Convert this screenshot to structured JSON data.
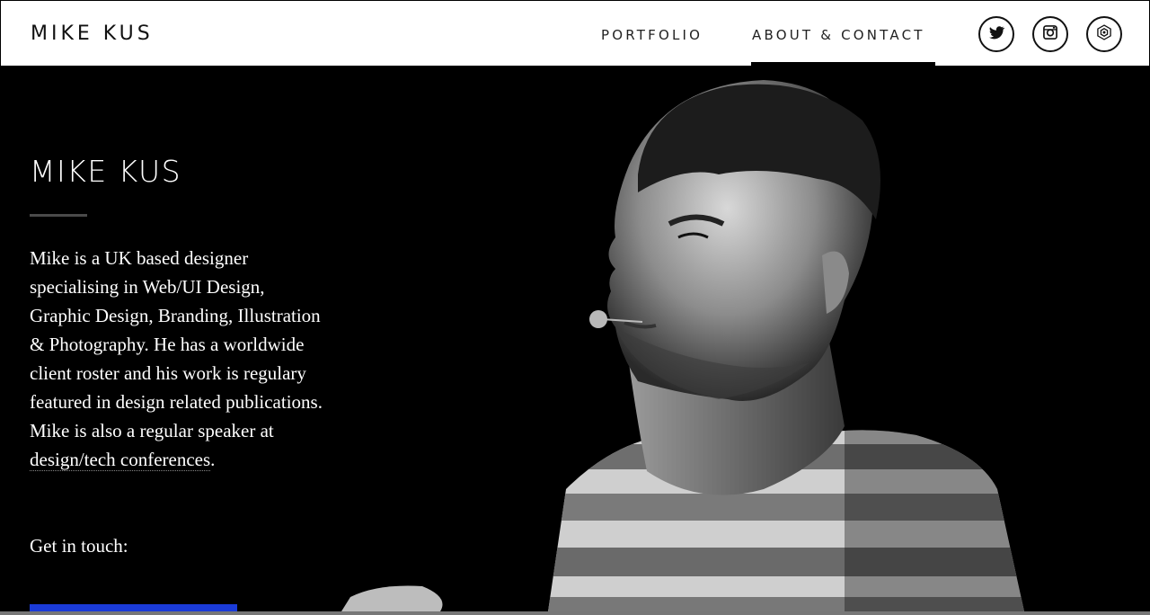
{
  "header": {
    "logo": "MIKE KUS",
    "nav": [
      {
        "label": "PORTFOLIO",
        "active": false
      },
      {
        "label": "ABOUT & CONTACT",
        "active": true
      }
    ],
    "social": [
      {
        "icon": "twitter-icon"
      },
      {
        "icon": "instagram-icon"
      },
      {
        "icon": "dribbble-icon"
      }
    ]
  },
  "hero": {
    "title": "MIKE KUS",
    "bio_text": "Mike is a UK based designer specialising in Web/UI Design, Graphic Design, Branding, Illustration & Photography. He has a worldwide client roster and his work is regulary featured in design related publications. Mike is also a regular speaker at ",
    "bio_link": "design/tech conferences",
    "bio_end": ".",
    "touch": "Get in touch:",
    "accent_color": "#1a3bd8"
  }
}
